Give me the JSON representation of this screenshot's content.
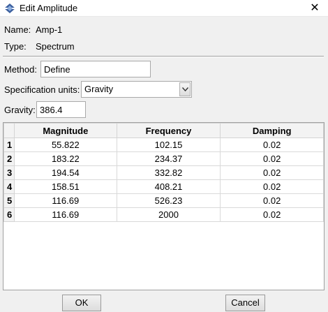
{
  "window": {
    "title": "Edit Amplitude",
    "close_glyph": "✕",
    "icon": "app-diamond-icon"
  },
  "info": {
    "name_label": "Name:",
    "name_value": "Amp-1",
    "type_label": "Type:",
    "type_value": "Spectrum"
  },
  "form": {
    "method_label": "Method:",
    "method_value": "Define",
    "units_label": "Specification units:",
    "units_value": "Gravity",
    "gravity_label": "Gravity:",
    "gravity_value": "386.4"
  },
  "table": {
    "columns": [
      "Magnitude",
      "Frequency",
      "Damping"
    ],
    "rows": [
      {
        "num": "1",
        "magnitude": "55.822",
        "frequency": "102.15",
        "damping": "0.02"
      },
      {
        "num": "2",
        "magnitude": "183.22",
        "frequency": "234.37",
        "damping": "0.02"
      },
      {
        "num": "3",
        "magnitude": "194.54",
        "frequency": "332.82",
        "damping": "0.02"
      },
      {
        "num": "4",
        "magnitude": "158.51",
        "frequency": "408.21",
        "damping": "0.02"
      },
      {
        "num": "5",
        "magnitude": "116.69",
        "frequency": "526.23",
        "damping": "0.02"
      },
      {
        "num": "6",
        "magnitude": "116.69",
        "frequency": "2000",
        "damping": "0.02"
      }
    ]
  },
  "buttons": {
    "ok": "OK",
    "cancel": "Cancel"
  },
  "colors": {
    "dialog_bg": "#f0f0f0",
    "header_bg": "#f3f3f3",
    "icon_blue": "#3b5f9e"
  }
}
